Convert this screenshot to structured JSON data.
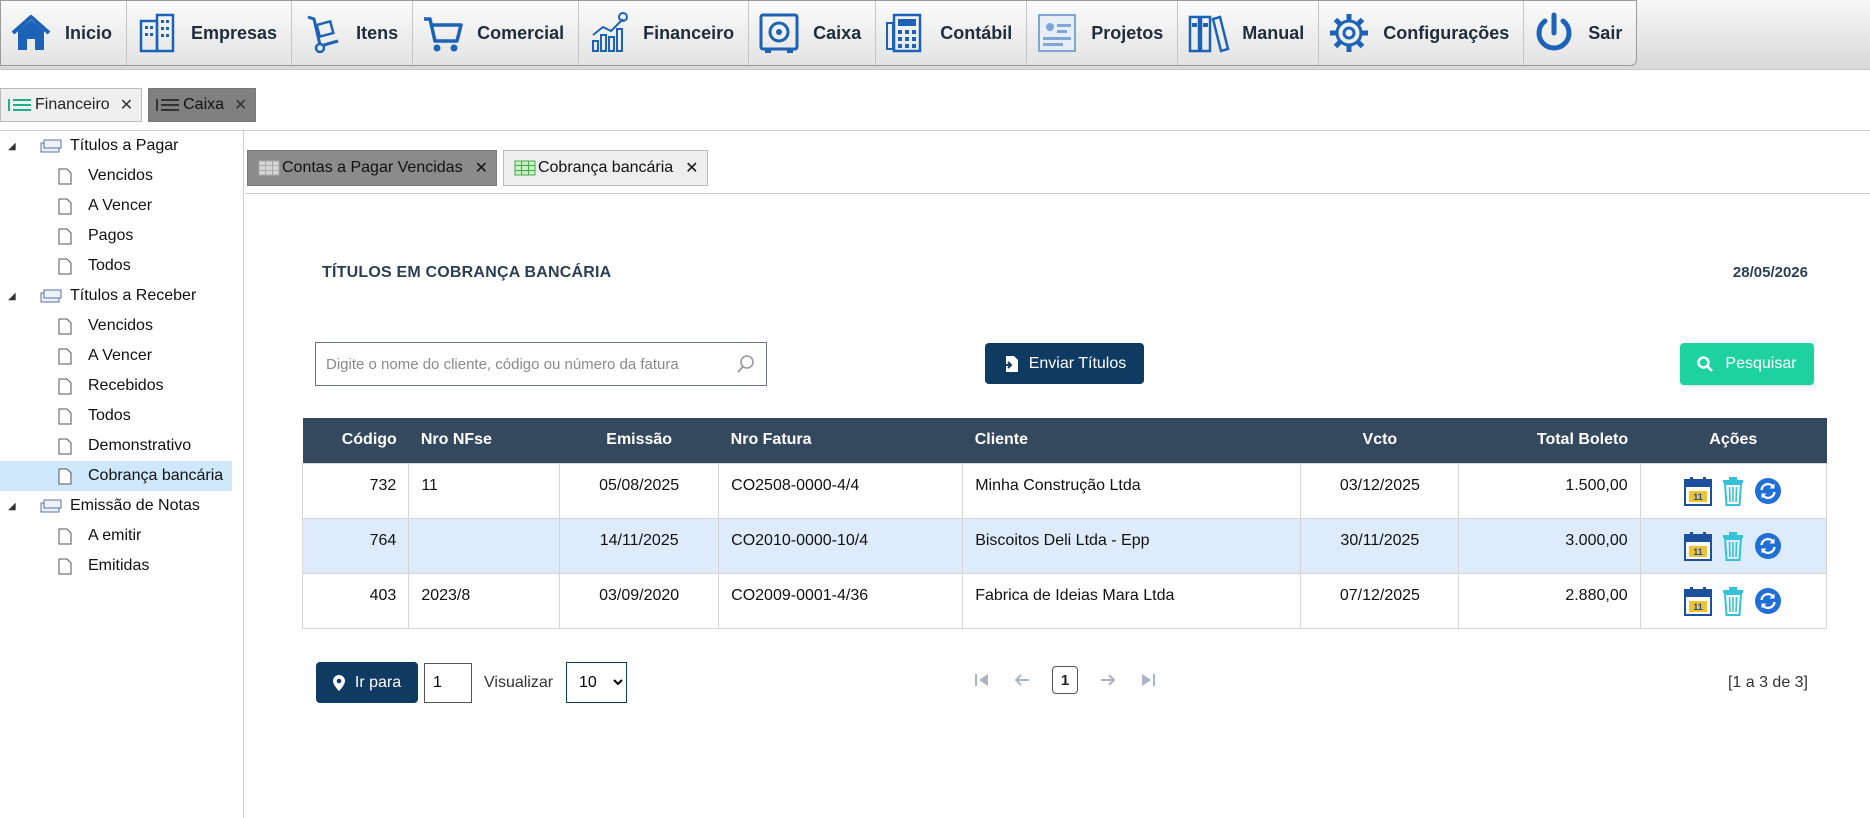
{
  "menu": [
    {
      "label": "Inicio",
      "icon": "home-icon"
    },
    {
      "label": "Empresas",
      "icon": "buildings-icon"
    },
    {
      "label": "Itens",
      "icon": "hand-truck-icon"
    },
    {
      "label": "Comercial",
      "icon": "cart-icon"
    },
    {
      "label": "Financeiro",
      "icon": "finance-chart-icon"
    },
    {
      "label": "Caixa",
      "icon": "safe-icon"
    },
    {
      "label": "Contábil",
      "icon": "calculator-icon"
    },
    {
      "label": "Projetos",
      "icon": "projects-icon"
    },
    {
      "label": "Manual",
      "icon": "binders-icon"
    },
    {
      "label": "Configurações",
      "icon": "gear-icon"
    },
    {
      "label": "Sair",
      "icon": "power-icon"
    }
  ],
  "module_tabs": [
    {
      "label": "Financeiro"
    },
    {
      "label": "Caixa"
    }
  ],
  "tree": {
    "pagar": {
      "label": "Títulos a Pagar",
      "items": [
        "Vencidos",
        "A Vencer",
        "Pagos",
        "Todos"
      ]
    },
    "receber": {
      "label": "Títulos a Receber",
      "items": [
        "Vencidos",
        "A Vencer",
        "Recebidos",
        "Todos",
        "Demonstrativo",
        "Cobrança bancária"
      ]
    },
    "notas": {
      "label": "Emissão de Notas",
      "items": [
        "A emitir",
        "Emitidas"
      ]
    }
  },
  "content_tabs": [
    {
      "label": "Contas a Pagar Vencidas"
    },
    {
      "label": "Cobrança bancária"
    }
  ],
  "page": {
    "title": "TÍTULOS EM COBRANÇA BANCÁRIA",
    "date": "28/05/2026"
  },
  "search": {
    "placeholder": "Digite o nome do cliente, código ou número da fatura",
    "value": ""
  },
  "buttons": {
    "send": "Enviar Títulos",
    "search": "Pesquisar",
    "goto": "Ir para"
  },
  "table": {
    "headers": [
      "Código",
      "Nro NFse",
      "Emissão",
      "Nro Fatura",
      "Cliente",
      "Vcto",
      "Total Boleto",
      "Ações"
    ],
    "rows": [
      [
        "732",
        "11",
        "05/08/2025",
        "CO2508-0000-4/4",
        "Minha Construção Ltda",
        "03/12/2025",
        "1.500,00"
      ],
      [
        "764",
        "",
        "14/11/2025",
        "CO2010-0000-10/4",
        "Biscoitos Deli Ltda - Epp",
        "30/11/2025",
        "3.000,00"
      ],
      [
        "403",
        "2023/8",
        "03/09/2020",
        "CO2009-0001-4/36",
        "Fabrica de Ideias Mara Ltda",
        "07/12/2025",
        "2.880,00"
      ]
    ]
  },
  "pagination": {
    "page_input": "1",
    "view_label": "Visualizar",
    "page_size": "10",
    "current_page": "1",
    "range": "[1 a 3 de 3]"
  },
  "colors": {
    "header_bg": "#34495e",
    "primary": "#0f3a62",
    "success": "#1dd1a1",
    "row_alt": "#deebfb",
    "menu_icon": "#1c63b7"
  }
}
